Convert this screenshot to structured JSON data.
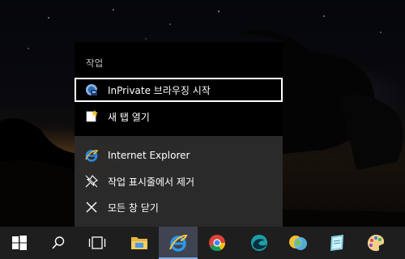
{
  "jump_list": {
    "header": "작업",
    "tasks": [
      {
        "label": "InPrivate 브라우징 시작",
        "icon": "inprivate-icon"
      },
      {
        "label": "새 탭 열기",
        "icon": "new-tab-icon"
      }
    ],
    "app_actions": [
      {
        "label": "Internet Explorer",
        "icon": "internet-explorer-icon"
      },
      {
        "label": "작업 표시줄에서 제거",
        "icon": "unpin-icon"
      },
      {
        "label": "모든 창 닫기",
        "icon": "close-icon"
      }
    ]
  },
  "taskbar": {
    "buttons": [
      {
        "name": "start-button",
        "icon": "windows-logo-icon"
      },
      {
        "name": "search-button",
        "icon": "search-icon"
      },
      {
        "name": "task-view-button",
        "icon": "task-view-icon"
      },
      {
        "name": "file-explorer-button",
        "icon": "folder-icon"
      },
      {
        "name": "internet-explorer-button",
        "icon": "internet-explorer-icon",
        "active": true
      },
      {
        "name": "chrome-button",
        "icon": "chrome-icon"
      },
      {
        "name": "edge-button",
        "icon": "edge-icon"
      },
      {
        "name": "app-button",
        "icon": "colored-circles-icon"
      },
      {
        "name": "app-button-2",
        "icon": "document-app-icon"
      },
      {
        "name": "paint-button",
        "icon": "paint-palette-icon"
      }
    ]
  },
  "colors": {
    "accent": "#79a9e6",
    "menu_bg": "#2b2b2b",
    "menu_top_bg": "#000000",
    "taskbar_bg": "#1e1e1f"
  }
}
